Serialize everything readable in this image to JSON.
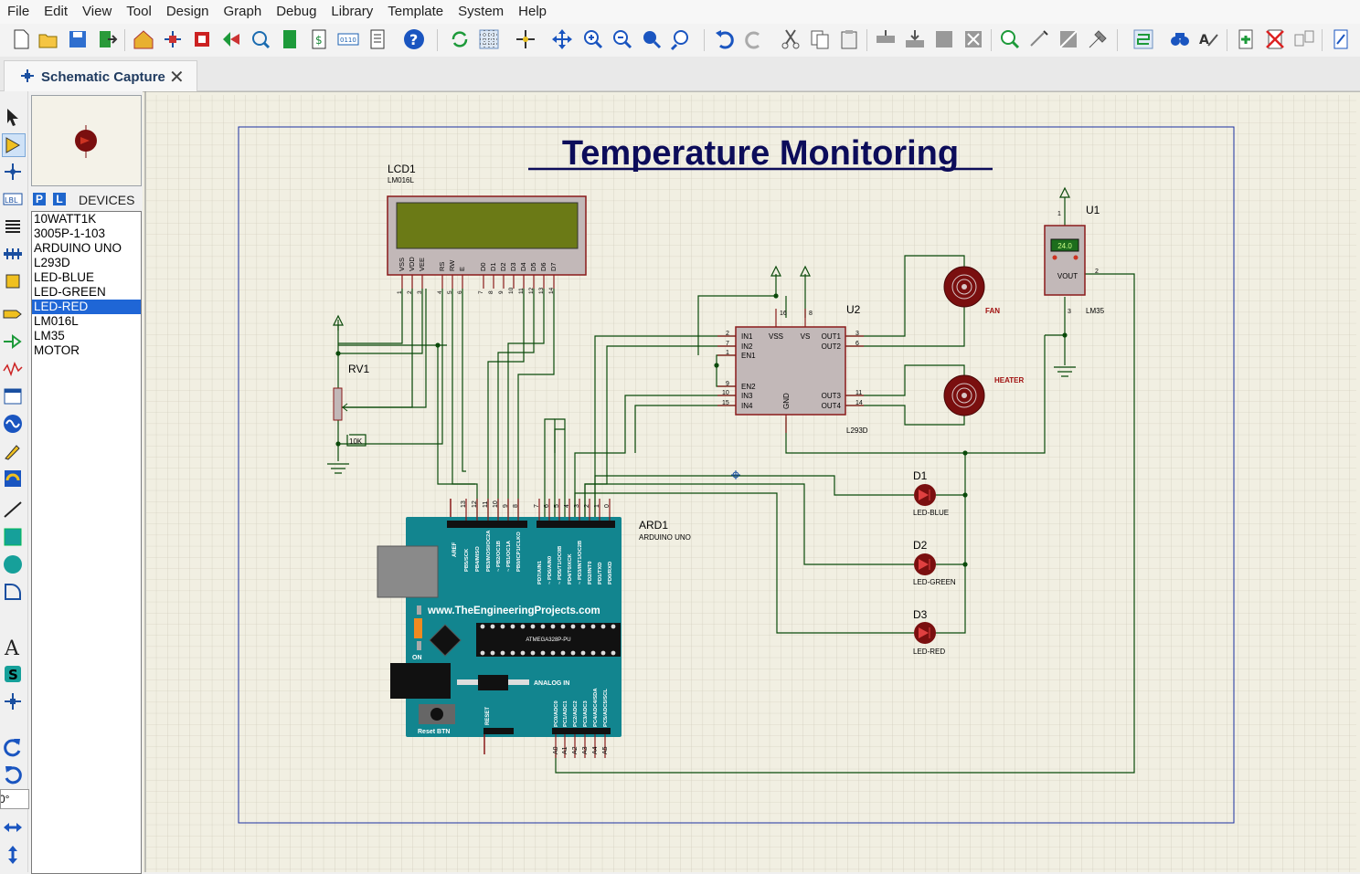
{
  "menu": [
    "File",
    "Edit",
    "View",
    "Tool",
    "Design",
    "Graph",
    "Debug",
    "Library",
    "Template",
    "System",
    "Help"
  ],
  "tab": {
    "label": "Schematic Capture"
  },
  "devices": {
    "header": "DEVICES",
    "p_btn": "P",
    "l_btn": "L",
    "items": [
      "10WATT1K",
      "3005P-1-103",
      "ARDUINO UNO",
      "L293D",
      "LED-BLUE",
      "LED-GREEN",
      "LED-RED",
      "LM016L",
      "LM35",
      "MOTOR"
    ],
    "selected": "LED-RED"
  },
  "rotation": "0°",
  "schematic": {
    "title": "Temperature Monitoring",
    "lcd": {
      "ref": "LCD1",
      "part": "LM016L",
      "pins": [
        "VSS",
        "VDD",
        "VEE",
        "RS",
        "RW",
        "E",
        "D0",
        "D1",
        "D2",
        "D3",
        "D4",
        "D5",
        "D6",
        "D7"
      ],
      "pin_numbers": [
        "1",
        "2",
        "3",
        "4",
        "5",
        "6",
        "7",
        "8",
        "9",
        "10",
        "11",
        "12",
        "13",
        "14"
      ]
    },
    "rv": {
      "ref": "RV1",
      "value": "10K"
    },
    "driver": {
      "ref": "U2",
      "part": "L293D",
      "left_pins": [
        "IN1",
        "IN2",
        "EN1",
        "EN2",
        "IN3",
        "IN4"
      ],
      "left_nums": [
        "2",
        "7",
        "1",
        "9",
        "10",
        "15"
      ],
      "right_pins": [
        "OUT1",
        "OUT2",
        "OUT3",
        "OUT4"
      ],
      "right_nums": [
        "3",
        "6",
        "11",
        "14"
      ],
      "top_pins": [
        "VSS",
        "VS"
      ],
      "top_nums": [
        "16",
        "8"
      ],
      "bottom_pin": "GND"
    },
    "sensor": {
      "ref": "U1",
      "part": "LM35",
      "display": "24.0",
      "pin": "VOUT",
      "pin1": "1",
      "pin2": "2",
      "pin3": "3"
    },
    "motors": {
      "fan": "FAN",
      "heater": "HEATER"
    },
    "leds": [
      {
        "ref": "D1",
        "part": "LED-BLUE"
      },
      {
        "ref": "D2",
        "part": "LED-GREEN"
      },
      {
        "ref": "D3",
        "part": "LED-RED"
      }
    ],
    "arduino": {
      "ref": "ARD1",
      "part": "ARDUINO UNO",
      "site": "www.TheEngineeringProjects.com",
      "on": "ON",
      "reset_btn": "Reset BTN",
      "reset": "RESET",
      "analog": "ANALOG IN",
      "aref": "AREF",
      "chip": "ATMEGA328P-PU",
      "dig_left_nums": [
        "13",
        "12",
        "11",
        "10",
        "9",
        "8"
      ],
      "dig_right_nums": [
        "7",
        "6",
        "5",
        "4",
        "3",
        "2",
        "1",
        "0"
      ],
      "dig_left_labels": [
        "PB5/SCK",
        "PB4/MISO",
        "PB3/MOSI/OC2A",
        "~ PB2/OC1B",
        "~ PB1/OC1A",
        "PB0/ICP1/CLKO"
      ],
      "dig_right_labels": [
        "PD7/AIN1",
        "~ PD6/AIN0",
        "~ PD5/T1/OC0B",
        "PD4/T0/XCK",
        "~ PD3/INT1/OC2B",
        "PD2/INT0",
        "PD1/TXD",
        "PD0/RXD"
      ],
      "analog_labels": [
        "PC0/ADC0",
        "PC1/ADC1",
        "PC2/ADC2",
        "PC3/ADC3",
        "PC4/ADC4/SDA",
        "PC5/ADC5/SCL"
      ],
      "analog_nums": [
        "A0",
        "A1",
        "A2",
        "A3",
        "A4",
        "A5"
      ]
    }
  }
}
